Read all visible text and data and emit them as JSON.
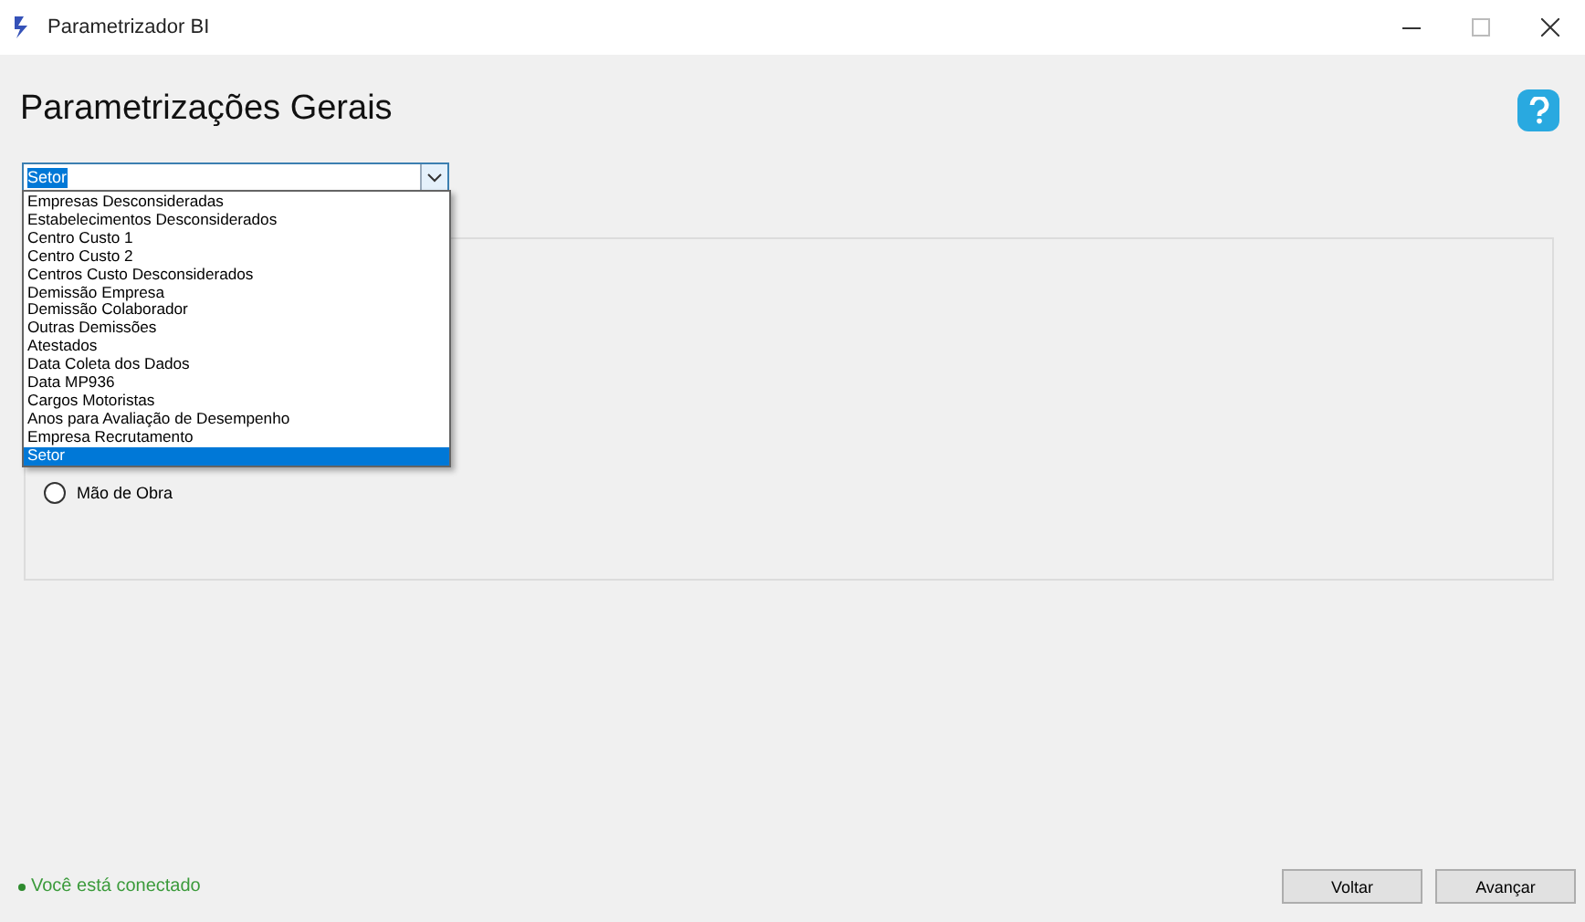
{
  "window": {
    "title": "Parametrizador BI"
  },
  "heading": "Parametrizações Gerais",
  "combo": {
    "value": "Setor",
    "expanded": true,
    "options": [
      {
        "label": "Empresas Desconsideradas",
        "selected": false
      },
      {
        "label": "Estabelecimentos Desconsiderados",
        "selected": false
      },
      {
        "label": "Centro Custo 1",
        "selected": false
      },
      {
        "label": "Centro Custo 2",
        "selected": false
      },
      {
        "label": "Centros Custo Desconsiderados",
        "selected": false
      },
      {
        "label": "Demissão Empresa",
        "selected": false
      },
      {
        "label": "Demissão Colaborador",
        "selected": false
      },
      {
        "label": "Outras Demissões",
        "selected": false
      },
      {
        "label": "Atestados",
        "selected": false
      },
      {
        "label": "Data Coleta dos Dados",
        "selected": false
      },
      {
        "label": "Data MP936",
        "selected": false
      },
      {
        "label": "Cargos Motoristas",
        "selected": false
      },
      {
        "label": "Anos para Avaliação de Desempenho",
        "selected": false
      },
      {
        "label": "Empresa Recrutamento",
        "selected": false
      },
      {
        "label": "Setor",
        "selected": true
      }
    ]
  },
  "radios": [
    {
      "label": "Mão de Obra",
      "selected": false
    }
  ],
  "status": "Você está conectado",
  "buttons": [
    "Voltar",
    "Avançar"
  ]
}
